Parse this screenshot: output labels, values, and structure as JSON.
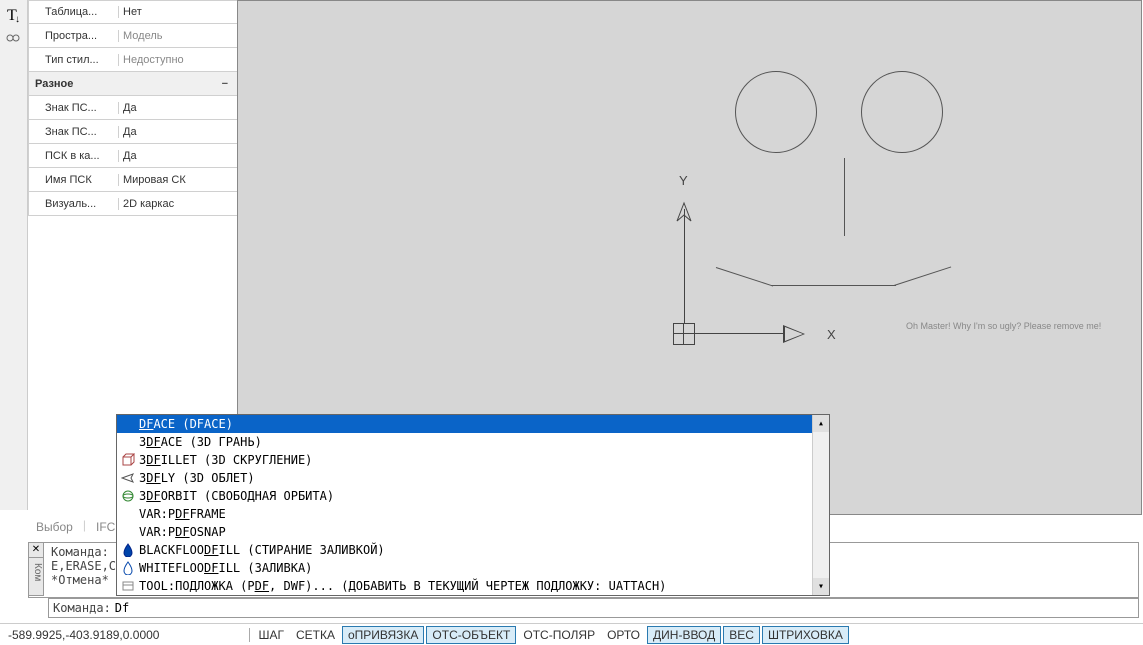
{
  "toolbar_icons": [
    "text-icon",
    "move-icon"
  ],
  "props": [
    {
      "key": "Таблица...",
      "val": "Нет",
      "indent": true
    },
    {
      "key": "Простра...",
      "val": "Модель",
      "indent": true,
      "unavailable": true
    },
    {
      "key": "Тип стил...",
      "val": "Недоступно",
      "indent": true,
      "unavailable": true
    },
    {
      "key": "Разное",
      "val": "",
      "group": true
    },
    {
      "key": "Знак ПС...",
      "val": "Да",
      "indent": true
    },
    {
      "key": "Знак ПС...",
      "val": "Да",
      "indent": true
    },
    {
      "key": "ПСК в ка...",
      "val": "Да",
      "indent": true
    },
    {
      "key": "Имя ПСК",
      "val": "Мировая СК",
      "indent": true
    },
    {
      "key": "Визуаль...",
      "val": "2D каркас",
      "indent": true
    }
  ],
  "panel_tabs": [
    "Выбор",
    "IFC"
  ],
  "ucs": {
    "x_label": "X",
    "y_label": "Y"
  },
  "face_text": "Oh Master! Why I'm so ugly? Please remove me!",
  "cmd_history": "Команда:\nE,ERASE,С\n*Отмена*",
  "cmd_tab_label": "Ком",
  "cmd_prompt": "Команда:",
  "cmd_value": "Df",
  "autocomplete": [
    {
      "icon": "",
      "pre": "",
      "u": "DF",
      "post": "ACE (DFACE)",
      "selected": true
    },
    {
      "icon": "",
      "pre": "3",
      "u": "DF",
      "post": "ACE (3D ГРАНЬ)"
    },
    {
      "icon": "cube",
      "pre": "3",
      "u": "DF",
      "post": "ILLET (3D СКРУГЛЕНИЕ)"
    },
    {
      "icon": "plane",
      "pre": "3",
      "u": "DF",
      "post": "LY (3D ОБЛЕТ)"
    },
    {
      "icon": "orbit",
      "pre": "3",
      "u": "DF",
      "post": "ORBIT (СВОБОДНАЯ ОРБИТА)"
    },
    {
      "icon": "",
      "pre": "VAR:P",
      "u": "DF",
      "post": "FRAME"
    },
    {
      "icon": "",
      "pre": "VAR:P",
      "u": "DF",
      "post": "OSNAP"
    },
    {
      "icon": "drop-black",
      "pre": "BLACKFLOO",
      "u": "DF",
      "post": "ILL (СТИРАНИЕ ЗАЛИВКОЙ)"
    },
    {
      "icon": "drop-white",
      "pre": "WHITEFLOO",
      "u": "DF",
      "post": "ILL (ЗАЛИВКА)"
    },
    {
      "icon": "sheet",
      "pre": "TOOL:ПОДЛОЖКА (P",
      "u": "DF",
      "post": ", DWF)... (ДОБАВИТЬ В ТЕКУЩИЙ ЧЕРТЕЖ ПОДЛОЖКУ: UATTACH)"
    }
  ],
  "status": {
    "coords": "-589.9925,-403.9189,0.0000",
    "buttons": [
      {
        "label": "ШАГ",
        "active": false
      },
      {
        "label": "СЕТКА",
        "active": false
      },
      {
        "label": "оПРИВЯЗКА",
        "active": true
      },
      {
        "label": "ОТС-ОБЪЕКТ",
        "active": true
      },
      {
        "label": "ОТС-ПОЛЯР",
        "active": false
      },
      {
        "label": "ОРТО",
        "active": false
      },
      {
        "label": "ДИН-ВВОД",
        "active": true
      },
      {
        "label": "ВЕС",
        "active": true
      },
      {
        "label": "ШТРИХОВКА",
        "active": true
      }
    ]
  }
}
